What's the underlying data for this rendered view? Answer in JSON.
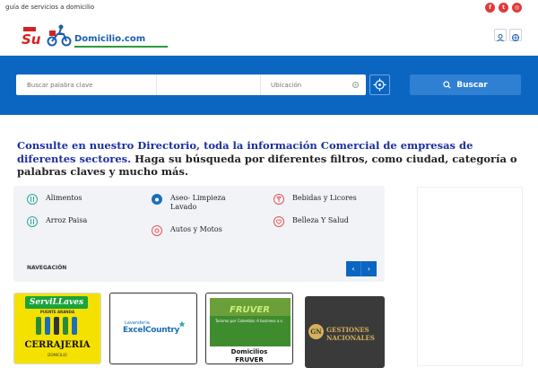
{
  "topbar": {
    "tagline": "guía de servicios a domicilio",
    "social": [
      {
        "icon": "facebook-icon",
        "glyph": "f"
      },
      {
        "icon": "twitter-icon",
        "glyph": "t"
      },
      {
        "icon": "instagram-icon",
        "glyph": "◎"
      }
    ]
  },
  "header": {
    "logo": {
      "part1": "Su",
      "part2": "Domicilio.com"
    },
    "icons": [
      "user-icon",
      "globe-icon"
    ]
  },
  "search": {
    "keyword_placeholder": "Buscar palabra clave",
    "location_placeholder": "Ubicación",
    "button_label": "Buscar"
  },
  "intro": {
    "lead": "Consulte en nuestro Directorio, toda la información Comercial de empresas de diferentes sectores.",
    "rest": " Haga su búsqueda por diferentes filtros, como ciudad, categoría o palabras claves y mucho más."
  },
  "categories": [
    {
      "label": "Alimentos",
      "color": "#2aa7a1",
      "icon": "utensils-icon"
    },
    {
      "label": "Aseo- Limpieza Lavado",
      "color": "#1b6fb8",
      "icon": "washing-icon"
    },
    {
      "label": "Bebidas y Licores",
      "color": "#e25555",
      "icon": "glass-icon"
    },
    {
      "label": "Arroz Paisa",
      "color": "#2aa7a1",
      "icon": "utensils-icon"
    },
    {
      "label": "Autos y Motos",
      "color": "#e25555",
      "icon": "wheel-icon"
    },
    {
      "label": "Belleza Y Salud",
      "color": "#e25555",
      "icon": "heart-icon"
    }
  ],
  "navigation": {
    "label": "NAVEGACIÓN",
    "prev": "‹",
    "next": "›"
  },
  "businesses": [
    {
      "title": "ServiLLaves",
      "subtitle": "PUENTE ARANDA",
      "caption": "CERRAJERIA",
      "small": "DOMICILIO"
    },
    {
      "line1": "Lavanderia",
      "line2": "ExcelCountry"
    },
    {
      "title": "FRUVER",
      "subtitle": "Turismo por Colombia: A business a.s.",
      "caption1": "Domicilios",
      "caption2": "FRUVER"
    },
    {
      "monogram": "GN",
      "line1": "GESTIONES",
      "line2": "NACIONALES"
    }
  ],
  "colors": {
    "band": "#0b66c2",
    "accent_red": "#d62222",
    "brand_blue": "#1b5fae",
    "intro_lead": "#1a2fa3"
  }
}
